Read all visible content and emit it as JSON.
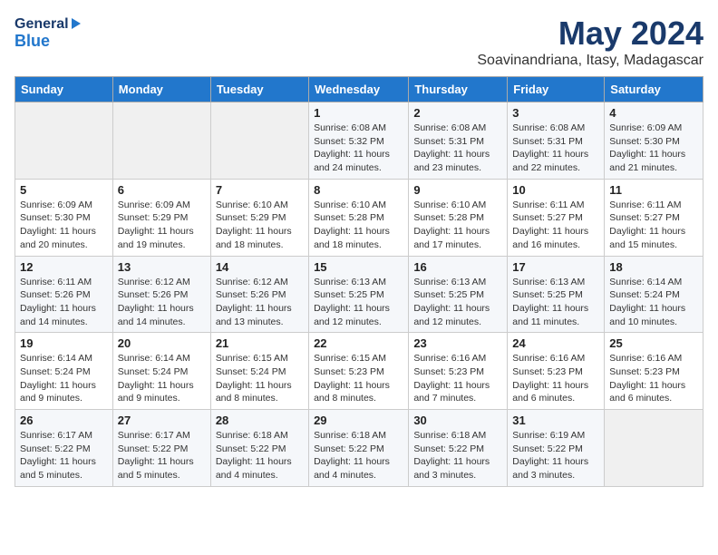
{
  "header": {
    "logo_general": "General",
    "logo_blue": "Blue",
    "month_title": "May 2024",
    "subtitle": "Soavinandriana, Itasy, Madagascar"
  },
  "days_of_week": [
    "Sunday",
    "Monday",
    "Tuesday",
    "Wednesday",
    "Thursday",
    "Friday",
    "Saturday"
  ],
  "weeks": [
    [
      {
        "day": "",
        "info": ""
      },
      {
        "day": "",
        "info": ""
      },
      {
        "day": "",
        "info": ""
      },
      {
        "day": "1",
        "info": "Sunrise: 6:08 AM\nSunset: 5:32 PM\nDaylight: 11 hours\nand 24 minutes."
      },
      {
        "day": "2",
        "info": "Sunrise: 6:08 AM\nSunset: 5:31 PM\nDaylight: 11 hours\nand 23 minutes."
      },
      {
        "day": "3",
        "info": "Sunrise: 6:08 AM\nSunset: 5:31 PM\nDaylight: 11 hours\nand 22 minutes."
      },
      {
        "day": "4",
        "info": "Sunrise: 6:09 AM\nSunset: 5:30 PM\nDaylight: 11 hours\nand 21 minutes."
      }
    ],
    [
      {
        "day": "5",
        "info": "Sunrise: 6:09 AM\nSunset: 5:30 PM\nDaylight: 11 hours\nand 20 minutes."
      },
      {
        "day": "6",
        "info": "Sunrise: 6:09 AM\nSunset: 5:29 PM\nDaylight: 11 hours\nand 19 minutes."
      },
      {
        "day": "7",
        "info": "Sunrise: 6:10 AM\nSunset: 5:29 PM\nDaylight: 11 hours\nand 18 minutes."
      },
      {
        "day": "8",
        "info": "Sunrise: 6:10 AM\nSunset: 5:28 PM\nDaylight: 11 hours\nand 18 minutes."
      },
      {
        "day": "9",
        "info": "Sunrise: 6:10 AM\nSunset: 5:28 PM\nDaylight: 11 hours\nand 17 minutes."
      },
      {
        "day": "10",
        "info": "Sunrise: 6:11 AM\nSunset: 5:27 PM\nDaylight: 11 hours\nand 16 minutes."
      },
      {
        "day": "11",
        "info": "Sunrise: 6:11 AM\nSunset: 5:27 PM\nDaylight: 11 hours\nand 15 minutes."
      }
    ],
    [
      {
        "day": "12",
        "info": "Sunrise: 6:11 AM\nSunset: 5:26 PM\nDaylight: 11 hours\nand 14 minutes."
      },
      {
        "day": "13",
        "info": "Sunrise: 6:12 AM\nSunset: 5:26 PM\nDaylight: 11 hours\nand 14 minutes."
      },
      {
        "day": "14",
        "info": "Sunrise: 6:12 AM\nSunset: 5:26 PM\nDaylight: 11 hours\nand 13 minutes."
      },
      {
        "day": "15",
        "info": "Sunrise: 6:13 AM\nSunset: 5:25 PM\nDaylight: 11 hours\nand 12 minutes."
      },
      {
        "day": "16",
        "info": "Sunrise: 6:13 AM\nSunset: 5:25 PM\nDaylight: 11 hours\nand 12 minutes."
      },
      {
        "day": "17",
        "info": "Sunrise: 6:13 AM\nSunset: 5:25 PM\nDaylight: 11 hours\nand 11 minutes."
      },
      {
        "day": "18",
        "info": "Sunrise: 6:14 AM\nSunset: 5:24 PM\nDaylight: 11 hours\nand 10 minutes."
      }
    ],
    [
      {
        "day": "19",
        "info": "Sunrise: 6:14 AM\nSunset: 5:24 PM\nDaylight: 11 hours\nand 9 minutes."
      },
      {
        "day": "20",
        "info": "Sunrise: 6:14 AM\nSunset: 5:24 PM\nDaylight: 11 hours\nand 9 minutes."
      },
      {
        "day": "21",
        "info": "Sunrise: 6:15 AM\nSunset: 5:24 PM\nDaylight: 11 hours\nand 8 minutes."
      },
      {
        "day": "22",
        "info": "Sunrise: 6:15 AM\nSunset: 5:23 PM\nDaylight: 11 hours\nand 8 minutes."
      },
      {
        "day": "23",
        "info": "Sunrise: 6:16 AM\nSunset: 5:23 PM\nDaylight: 11 hours\nand 7 minutes."
      },
      {
        "day": "24",
        "info": "Sunrise: 6:16 AM\nSunset: 5:23 PM\nDaylight: 11 hours\nand 6 minutes."
      },
      {
        "day": "25",
        "info": "Sunrise: 6:16 AM\nSunset: 5:23 PM\nDaylight: 11 hours\nand 6 minutes."
      }
    ],
    [
      {
        "day": "26",
        "info": "Sunrise: 6:17 AM\nSunset: 5:22 PM\nDaylight: 11 hours\nand 5 minutes."
      },
      {
        "day": "27",
        "info": "Sunrise: 6:17 AM\nSunset: 5:22 PM\nDaylight: 11 hours\nand 5 minutes."
      },
      {
        "day": "28",
        "info": "Sunrise: 6:18 AM\nSunset: 5:22 PM\nDaylight: 11 hours\nand 4 minutes."
      },
      {
        "day": "29",
        "info": "Sunrise: 6:18 AM\nSunset: 5:22 PM\nDaylight: 11 hours\nand 4 minutes."
      },
      {
        "day": "30",
        "info": "Sunrise: 6:18 AM\nSunset: 5:22 PM\nDaylight: 11 hours\nand 3 minutes."
      },
      {
        "day": "31",
        "info": "Sunrise: 6:19 AM\nSunset: 5:22 PM\nDaylight: 11 hours\nand 3 minutes."
      },
      {
        "day": "",
        "info": ""
      }
    ]
  ]
}
